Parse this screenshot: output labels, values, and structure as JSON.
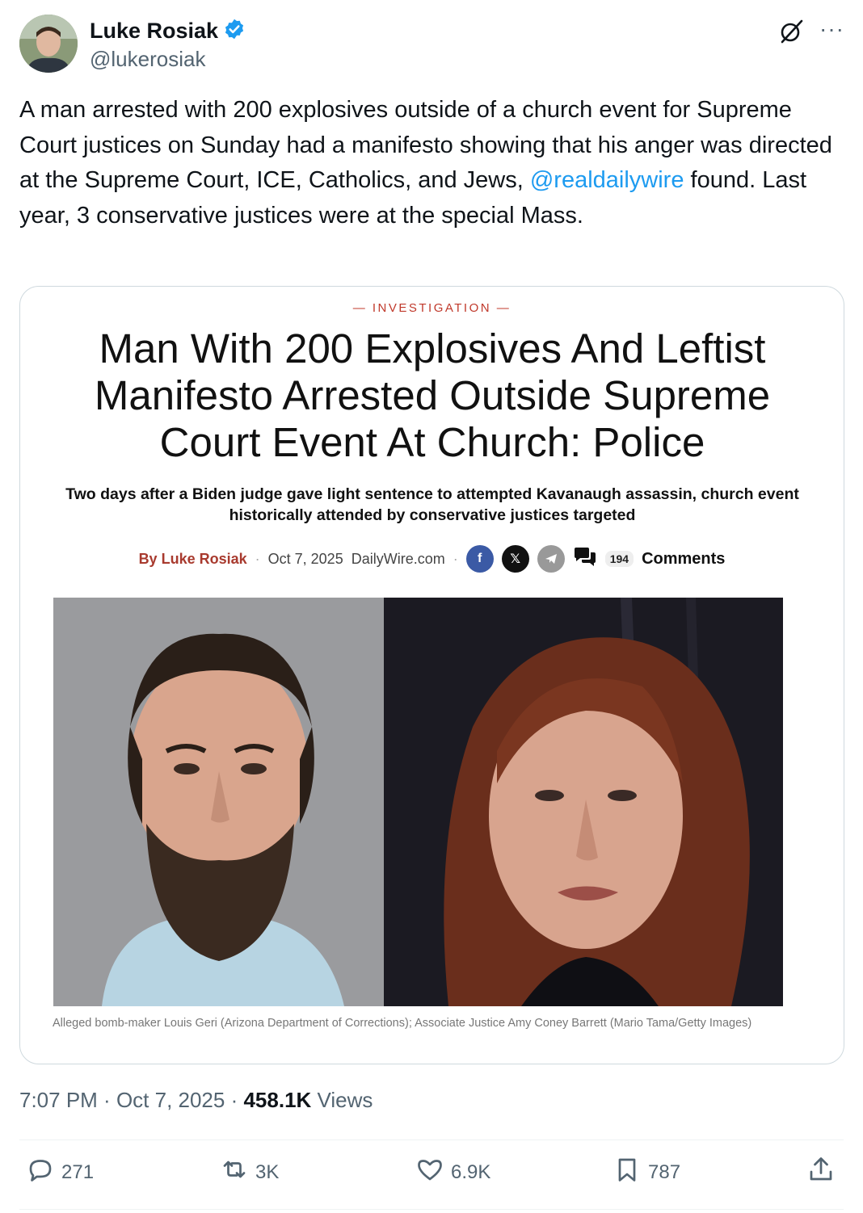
{
  "author": {
    "name": "Luke Rosiak",
    "handle": "@lukerosiak",
    "verified": true
  },
  "tweet": {
    "text_before": "A man arrested with 200 explosives outside of a church event for Supreme Court justices on Sunday had a manifesto showing that his anger was directed at the Supreme Court, ICE, Catholics, and Jews, ",
    "mention": "@realdailywire",
    "text_after": " found. Last year, 3 conservative justices were at the special Mass."
  },
  "card": {
    "kicker": "— INVESTIGATION —",
    "headline": "Man With 200 Explosives And Leftist Manifesto Arrested Outside Supreme Court Event At Church: Police",
    "subhead": "Two days after a Biden judge gave light sentence to attempted Kavanaugh assassin, church event historically attended by conservative justices targeted",
    "byline_by": "By",
    "byline_author": "Luke Rosiak",
    "date": "Oct 7, 2025",
    "site": "DailyWire.com",
    "comment_count": "194",
    "comments_label": "Comments",
    "caption": "Alleged bomb-maker Louis Geri (Arizona Department of Corrections); Associate Justice Amy Coney Barrett (Mario Tama/Getty Images)"
  },
  "meta": {
    "time": "7:07 PM",
    "sep1": " · ",
    "date": "Oct 7, 2025",
    "sep2": " · ",
    "views_count": "458.1K",
    "views_label": " Views"
  },
  "actions": {
    "replies": "271",
    "reposts": "3K",
    "likes": "6.9K",
    "bookmarks": "787"
  },
  "colors": {
    "accent": "#1d9bf0",
    "secondary_text": "#536471",
    "kicker_red": "#c0392b"
  }
}
